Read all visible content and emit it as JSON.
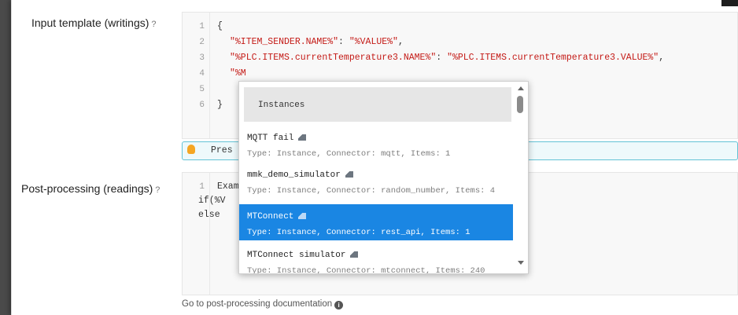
{
  "form": {
    "input_template_label": "Input template (writings)",
    "post_processing_label": "Post-processing (readings)",
    "help_glyph": "?",
    "doc_link": "Go to post-processing documentation",
    "info_glyph": "i"
  },
  "input_editor": {
    "line_numbers": [
      "1",
      "2",
      "3",
      "4",
      "5",
      "6"
    ],
    "line1": "{",
    "line2_key": "\"%ITEM_SENDER.NAME%\"",
    "line2_sep": ": ",
    "line2_value": "\"%VALUE%\"",
    "line2_end": ",",
    "line3_key": "\"%PLC.ITEMS.currentTemperature3.NAME%\"",
    "line3_sep": ": ",
    "line3_value": "\"%PLC.ITEMS.currentTemperature3.VALUE%\"",
    "line3_end": ",",
    "line4": "\"%M",
    "line6": "}"
  },
  "tip": {
    "text": "Pres"
  },
  "post_editor": {
    "line_number": "1",
    "line1": "Examp",
    "line2": "if(%V",
    "line3": "else"
  },
  "autocomplete": {
    "header": "Instances",
    "items": [
      {
        "name": "MQTT fail",
        "desc": "Type: Instance, Connector: mqtt, Items: 1",
        "icon": "factory-icon"
      },
      {
        "name": "mmk_demo_simulator",
        "desc": "Type: Instance, Connector: random_number, Items: 4",
        "icon": "factory-icon"
      },
      {
        "name": "MTConnect",
        "desc": "Type: Instance, Connector: rest_api, Items: 1",
        "icon": "factory-icon",
        "selected": true
      },
      {
        "name": "MTConnect simulator",
        "desc": "Type: Instance, Connector: mtconnect, Items: 240",
        "icon": "factory-icon"
      }
    ]
  },
  "colors": {
    "selection": "#1a86e3",
    "string": "#c41a16",
    "tip_border": "#63c3d5"
  }
}
